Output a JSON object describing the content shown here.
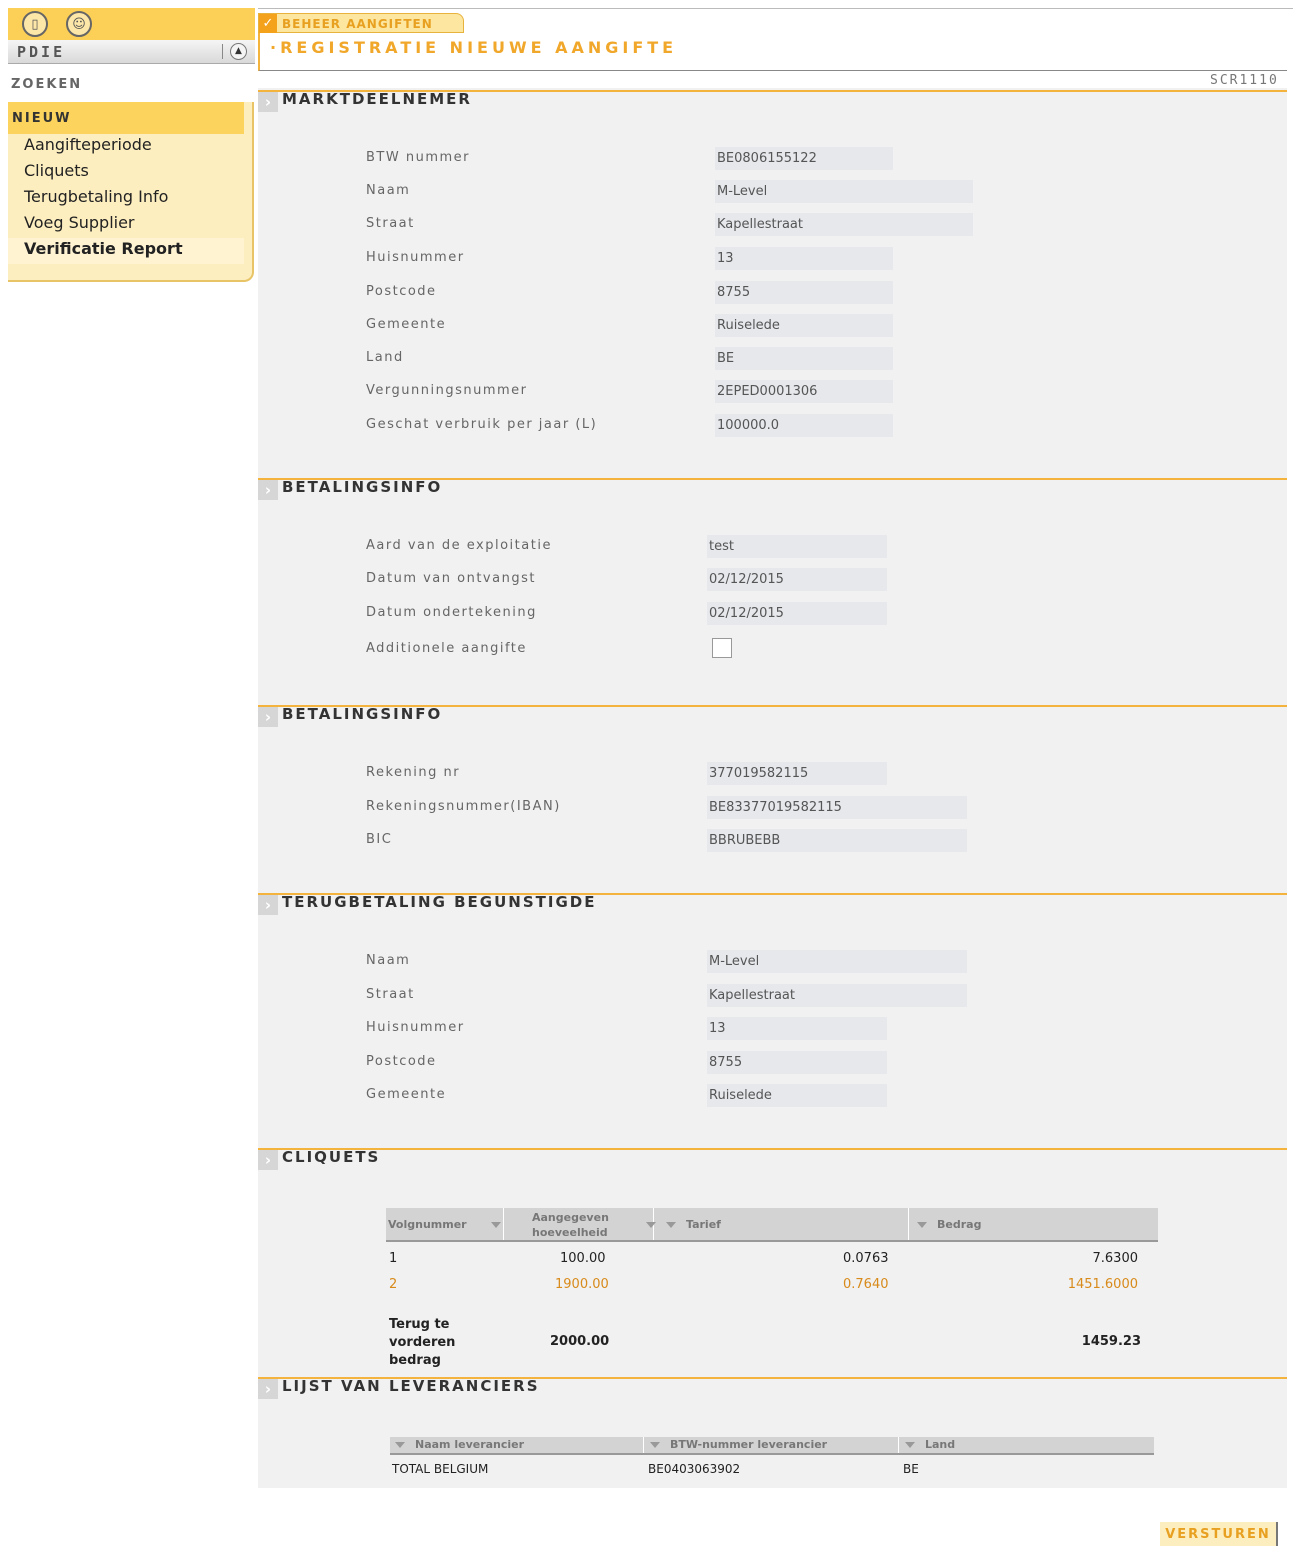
{
  "sidebar": {
    "app_name": "PDIE",
    "zoeken": "ZOEKEN",
    "nieuw": "NIEUW",
    "items": [
      {
        "label": "Aangifteperiode"
      },
      {
        "label": "Cliquets"
      },
      {
        "label": "Terugbetaling Info"
      },
      {
        "label": "Voeg Supplier"
      },
      {
        "label": "Verificatie Report"
      }
    ]
  },
  "header": {
    "tab": "BEHEER AANGIFTEN",
    "title": "·REGISTRATIE NIEUWE AANGIFTE",
    "screen_code": "SCR1110"
  },
  "marktdeelnemer": {
    "title": "MARKTDEELNEMER",
    "fields": [
      {
        "label": "BTW nummer",
        "value": "BE0806155122"
      },
      {
        "label": "Naam",
        "value": "M-Level"
      },
      {
        "label": "Straat",
        "value": "Kapellestraat"
      },
      {
        "label": "Huisnummer",
        "value": "13"
      },
      {
        "label": "Postcode",
        "value": "8755"
      },
      {
        "label": "Gemeente",
        "value": "Ruiselede"
      },
      {
        "label": "Land",
        "value": "BE"
      },
      {
        "label": "Vergunningsnummer",
        "value": "2EPED0001306"
      },
      {
        "label": "Geschat verbruik per jaar (L)",
        "value": "100000.0"
      }
    ]
  },
  "betalingsinfo1": {
    "title": "BETALINGSINFO",
    "fields": [
      {
        "label": "Aard van de exploitatie",
        "value": "test"
      },
      {
        "label": "Datum van ontvangst",
        "value": "02/12/2015"
      },
      {
        "label": "Datum ondertekening",
        "value": "02/12/2015"
      },
      {
        "label": "Additionele aangifte",
        "value": ""
      }
    ]
  },
  "betalingsinfo2": {
    "title": "BETALINGSINFO",
    "fields": [
      {
        "label": "Rekening nr",
        "value": "377019582115"
      },
      {
        "label": "Rekeningsnummer(IBAN)",
        "value": "BE83377019582115"
      },
      {
        "label": "BIC",
        "value": "BBRUBEBB"
      }
    ]
  },
  "terugbetaling": {
    "title": "TERUGBETALING BEGUNSTIGDE",
    "fields": [
      {
        "label": "Naam",
        "value": "M-Level"
      },
      {
        "label": "Straat",
        "value": "Kapellestraat"
      },
      {
        "label": "Huisnummer",
        "value": "13"
      },
      {
        "label": "Postcode",
        "value": "8755"
      },
      {
        "label": "Gemeente",
        "value": "Ruiselede"
      }
    ]
  },
  "cliquets": {
    "title": "CLIQUETS",
    "headers": [
      "Volgnummer",
      "Aangegeven hoeveelheid",
      "Tarief",
      "Bedrag"
    ],
    "rows": [
      {
        "nr": "1",
        "hoeveelheid": "100.00",
        "tarief": "0.0763",
        "bedrag": "7.6300"
      },
      {
        "nr": "2",
        "hoeveelheid": "1900.00",
        "tarief": "0.7640",
        "bedrag": "1451.6000"
      }
    ],
    "total_label": "Terug te vorderen bedrag",
    "total_hoeveelheid": "2000.00",
    "total_bedrag": "1459.23"
  },
  "leveranciers": {
    "title": "LIJST VAN LEVERANCIERS",
    "headers": [
      "Naam leverancier",
      "BTW-nummer leverancier",
      "Land"
    ],
    "rows": [
      {
        "naam": "TOTAL BELGIUM",
        "btw": "BE0403063902",
        "land": "BE"
      }
    ]
  },
  "actions": {
    "submit": "VERSTUREN"
  },
  "colors": {
    "accent": "#f4b33c",
    "sidebar_yellow": "#fccf56",
    "field_bg": "#e6e8ec",
    "content_bg": "#f1f1f1"
  }
}
